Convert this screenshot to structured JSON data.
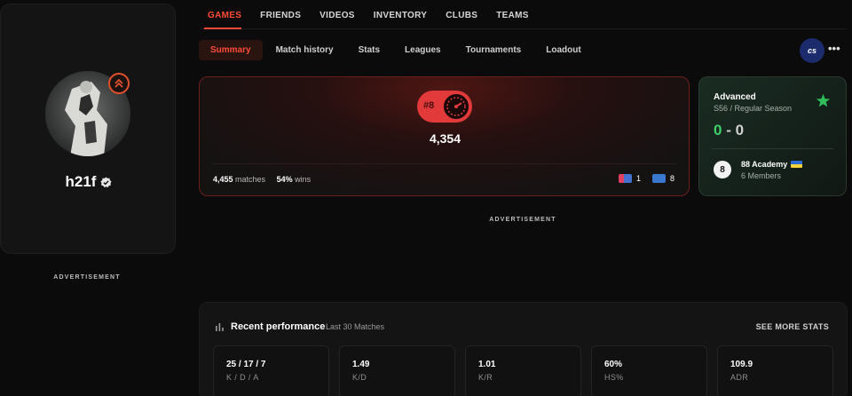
{
  "profile": {
    "username": "h21f",
    "verified": true,
    "advertisement_label": "ADVERTISEMENT"
  },
  "top_nav": {
    "items": [
      "GAMES",
      "FRIENDS",
      "VIDEOS",
      "INVENTORY",
      "CLUBS",
      "TEAMS"
    ],
    "active": "GAMES"
  },
  "sub_nav": {
    "items": [
      "Summary",
      "Match history",
      "Stats",
      "Leagues",
      "Tournaments",
      "Loadout"
    ],
    "active": "Summary",
    "game_logo_text": "cs",
    "more_label": "•••"
  },
  "elo_card": {
    "rank": "#8",
    "elo": "4,354",
    "matches_value": "4,455",
    "matches_label": "matches",
    "wins_value": "54%",
    "wins_label": "wins",
    "flag_a_count": "1",
    "flag_b_count": "8"
  },
  "league_card": {
    "title": "Advanced",
    "subtitle": "S56 / Regular Season",
    "wins": "0",
    "losses": "0",
    "separator": "-",
    "club_logo_text": "8",
    "club_name": "88 Academy",
    "club_members": "6 Members"
  },
  "advertisement": {
    "center_label": "ADVERTISEMENT"
  },
  "performance": {
    "title": "Recent performance",
    "subtitle": "Last 30 Matches",
    "see_more": "SEE MORE STATS",
    "stats": [
      {
        "value": "25 / 17 / 7",
        "label": "K / D / A"
      },
      {
        "value": "1.49",
        "label": "K/D"
      },
      {
        "value": "1.01",
        "label": "K/R"
      },
      {
        "value": "60%",
        "label": "HS%"
      },
      {
        "value": "109.9",
        "label": "ADR"
      }
    ]
  },
  "colors": {
    "accent": "#ff4b36",
    "win_green": "#3fcf6a",
    "elo_red": "#e23a3a"
  }
}
